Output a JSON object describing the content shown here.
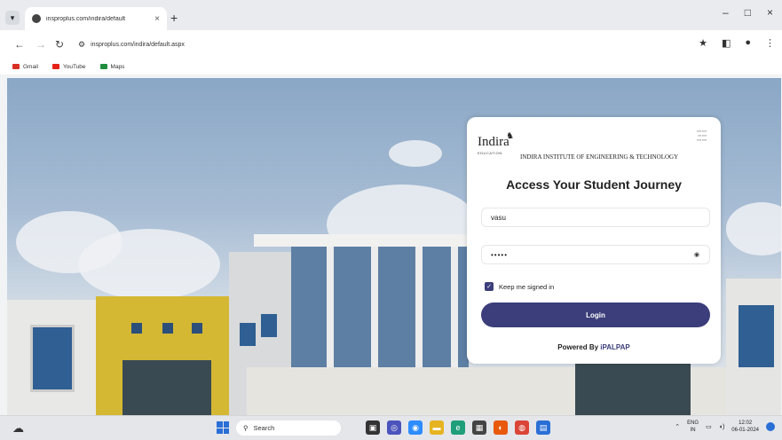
{
  "browser": {
    "tab_title": "insproplus.com/indira/default",
    "tab_close": "×",
    "new_tab": "+",
    "url": "insproplus.com/indira/default.aspx",
    "window_controls": [
      "–",
      "□",
      "×"
    ]
  },
  "bookmarks": [
    {
      "label": "Gmail",
      "color": "#d93025"
    },
    {
      "label": "YouTube",
      "color": "#e62117"
    },
    {
      "label": "Maps",
      "color": "#1e8e3e"
    }
  ],
  "login": {
    "logo_text": "Indira",
    "logo_subtext": "EDUCATION",
    "institute_name": "INDIRA INSTITUTE OF ENGINEERING & TECHNOLOGY",
    "heading": "Access Your Student Journey",
    "username_value": "vasu",
    "password_value": "•••••",
    "remember_label": "Keep me signed in",
    "remember_checked": true,
    "login_label": "Login",
    "powered_prefix": "Powered By ",
    "powered_brand": "iPALPAP"
  },
  "taskbar": {
    "search_label": "Search",
    "lang_line1": "ENG",
    "lang_line2": "IN",
    "time": "12:02",
    "date": "06-01-2024"
  },
  "colors": {
    "accent": "#3b3e7a",
    "windows_blue": "#2a6fd6"
  }
}
